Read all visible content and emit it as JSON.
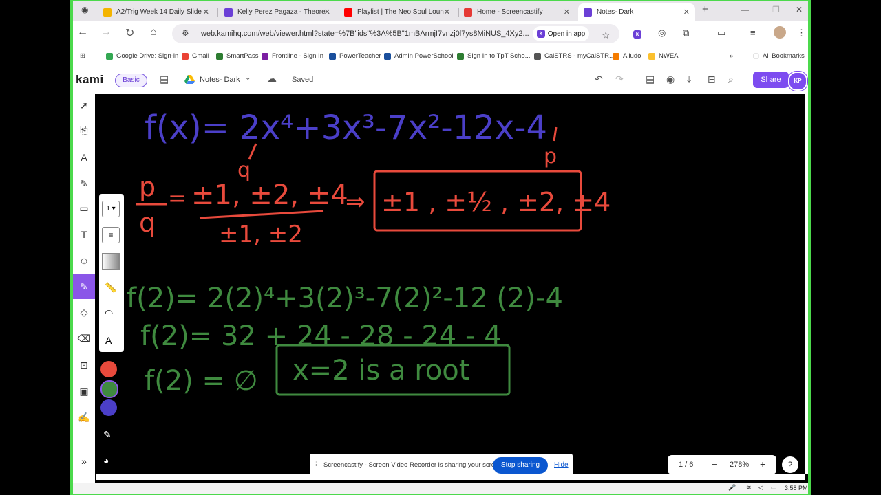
{
  "browser": {
    "tabs": [
      {
        "label": "A2/Trig Week 14 Daily Slide",
        "color": "#f4b400"
      },
      {
        "label": "Kelly Perez Pagaza - Theore",
        "color": "#6b3fd6"
      },
      {
        "label": "Playlist | The Neo Soul Loun",
        "color": "#ff0000"
      },
      {
        "label": "Home - Screencastify",
        "color": "#e53935"
      },
      {
        "label": "Notes- Dark",
        "color": "#6b3fd6"
      }
    ],
    "url": "web.kamihq.com/web/viewer.html?state=%7B\"ids\"%3A%5B\"1mBArmjI7vnzj0l7ys8MiNUS_4Xy2...",
    "open_in_app": "Open in app",
    "bookmarks": [
      "Google Drive: Sign-in",
      "Gmail",
      "SmartPass",
      "Frontline - Sign In",
      "PowerTeacher",
      "Admin PowerSchool",
      "Sign In to TpT Scho...",
      "CalSTRS - myCalSTR...",
      "Alludo",
      "NWEA"
    ],
    "all_bookmarks": "All Bookmarks"
  },
  "kami": {
    "logo": "kami",
    "plan": "Basic",
    "doc_name": "Notes- Dark",
    "saved": "Saved",
    "share": "Share",
    "avatar": "KP",
    "stroke_width": "1"
  },
  "canvas": {
    "line1": "f(x)= 2x⁴+3x³-7x²-12x-4",
    "q_label": "q",
    "p_label": "p",
    "pq_num": "±1, ±2, ±4",
    "pq_den": "±1, ±2",
    "p_over_q": "p",
    "q_under": "q",
    "arrow": "⇒",
    "candidates": "±1 , ±½ , ±2, ±4",
    "eval1": "f(2)= 2(2)⁴+3(2)³-7(2)²-12 (2)-4",
    "eval2": "f(2)=   32 + 24 - 28 - 24 - 4",
    "eval3_left": "f(2) = ∅",
    "eval3_box": "x=2  is a root"
  },
  "footer": {
    "page": "1 / 6",
    "zoom": "278%",
    "banner_text": "Screencastify - Screen Video Recorder is sharing your screen.",
    "stop_sharing": "Stop sharing",
    "hide": "Hide",
    "clock": "3:58 PM"
  },
  "colors": {
    "blue_ink": "#4b3fc8",
    "red_ink": "#e84a3c",
    "green_ink": "#3f8a3f",
    "accent": "#7d4cf0"
  }
}
